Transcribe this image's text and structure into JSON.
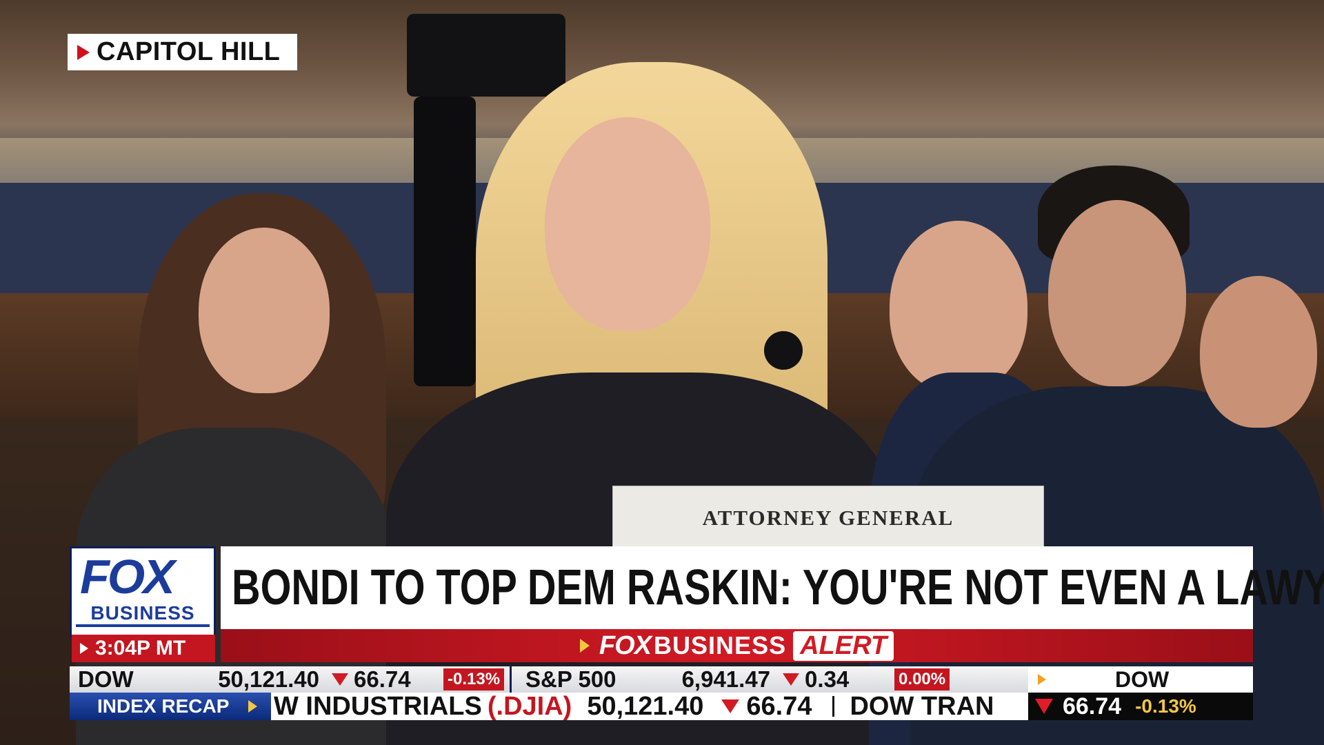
{
  "location": {
    "label": "CAPITOL HILL"
  },
  "nameplate": {
    "text": "ATTORNEY GENERAL"
  },
  "network": {
    "fox": "FOX",
    "business": "BUSINESS",
    "time": "3:04P MT"
  },
  "headline": {
    "text": "BONDI TO TOP DEM RASKIN: YOU'RE NOT EVEN A LAWYER"
  },
  "alert": {
    "fox": "FOX",
    "business": "BUSINESS",
    "alert": "ALERT"
  },
  "ticker": {
    "dow": {
      "symbol": "DOW",
      "value": "50,121.40",
      "change": "66.74",
      "percent": "-0.13%"
    },
    "sp500": {
      "symbol": "S&P 500",
      "value": "6,941.47",
      "change": "0.34",
      "percent": "0.00%"
    },
    "right_label": "DOW",
    "right_change": "66.74",
    "right_percent": "-0.13%"
  },
  "crawl": {
    "section": "INDEX RECAP",
    "name": "W INDUSTRIALS",
    "ticker": "(.DJIA)",
    "value": "50,121.40",
    "change": "66.74",
    "next": "DOW TRAN"
  },
  "colors": {
    "brand_blue": "#1c3c9c",
    "alert_red": "#d21a24",
    "down_red": "#d21a24",
    "accent_yellow": "#f4c742"
  }
}
